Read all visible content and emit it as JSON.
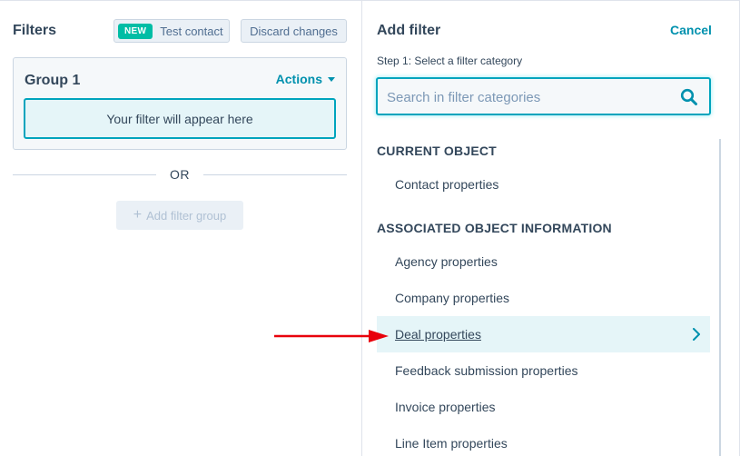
{
  "left": {
    "title": "Filters",
    "new_badge": "NEW",
    "test_contact_label": "Test contact",
    "discard_label": "Discard changes",
    "group": {
      "title": "Group 1",
      "actions_label": "Actions",
      "placeholder": "Your filter will appear here"
    },
    "or_label": "OR",
    "add_group_label": "Add filter group"
  },
  "right": {
    "title": "Add filter",
    "cancel_label": "Cancel",
    "step_label": "Step 1: Select a filter category",
    "search": {
      "placeholder": "Search in filter categories",
      "value": ""
    },
    "sections": [
      {
        "header": "CURRENT OBJECT",
        "items": [
          "Contact properties"
        ]
      },
      {
        "header": "ASSOCIATED OBJECT INFORMATION",
        "items": [
          "Agency properties",
          "Company properties",
          "Deal properties",
          "Feedback submission properties",
          "Invoice properties",
          "Line Item properties"
        ]
      }
    ],
    "hovered_item": "Deal properties"
  },
  "colors": {
    "accent": "#0091ae",
    "teal_border": "#00a4bd",
    "new_badge": "#00bda5",
    "hover_bg": "#e5f5f8",
    "annotation_arrow": "#e8000b"
  },
  "icons": {
    "search": "search-icon",
    "chevron": "chevron-right-icon",
    "caret": "caret-down-icon",
    "plus": "plus-icon"
  }
}
